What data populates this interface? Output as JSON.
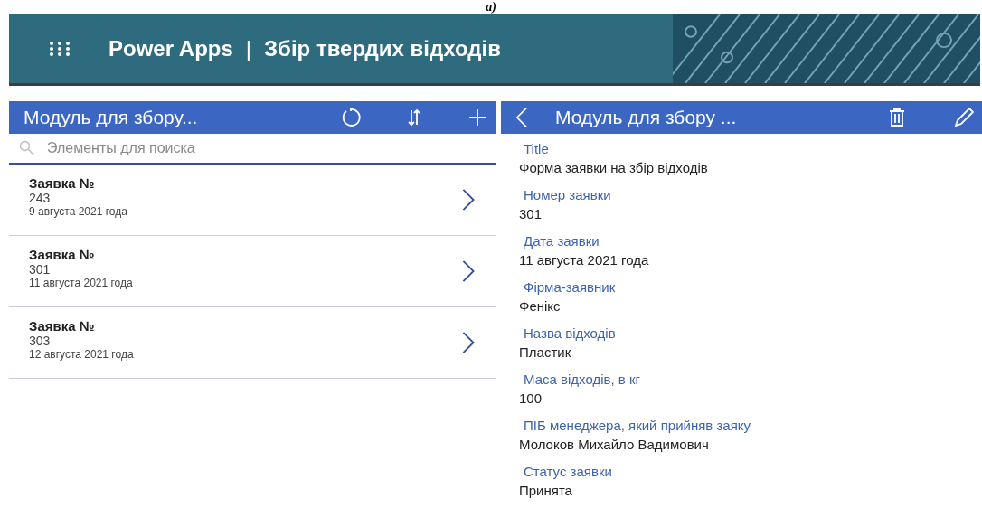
{
  "caption": "a)",
  "app_bar": {
    "brand": "Power Apps",
    "separator": "|",
    "app_name": "Збір твердих відходів"
  },
  "list_panel": {
    "title": "Модуль для збору...",
    "search": {
      "placeholder": "Элементы для поиска"
    },
    "items": [
      {
        "title": "Заявка №",
        "number": "243",
        "date": "9 августа 2021 года",
        "selected": false
      },
      {
        "title": "Заявка №",
        "number": "301",
        "date": "11 августа 2021 года",
        "selected": false
      },
      {
        "title": "Заявка №",
        "number": "303",
        "date": "12 августа 2021 года",
        "selected": false
      }
    ]
  },
  "detail_panel": {
    "title": "Модуль для збору ...",
    "fields": [
      {
        "label": "Title",
        "value": "Форма заявки на збір відходів"
      },
      {
        "label": "Номер заявки",
        "value": "301"
      },
      {
        "label": "Дата заявки",
        "value": "11 августа 2021 года"
      },
      {
        "label": "Фірма-заявник",
        "value": "Фенікс"
      },
      {
        "label": "Назва відходів",
        "value": "Пластик"
      },
      {
        "label": "Маса відходів, в кг",
        "value": "100"
      },
      {
        "label": "ПІБ менеджера, який прийняв заяку",
        "value": "Молоков Михайло Вадимович"
      },
      {
        "label": "Статус заявки",
        "value": "Принята"
      }
    ]
  }
}
